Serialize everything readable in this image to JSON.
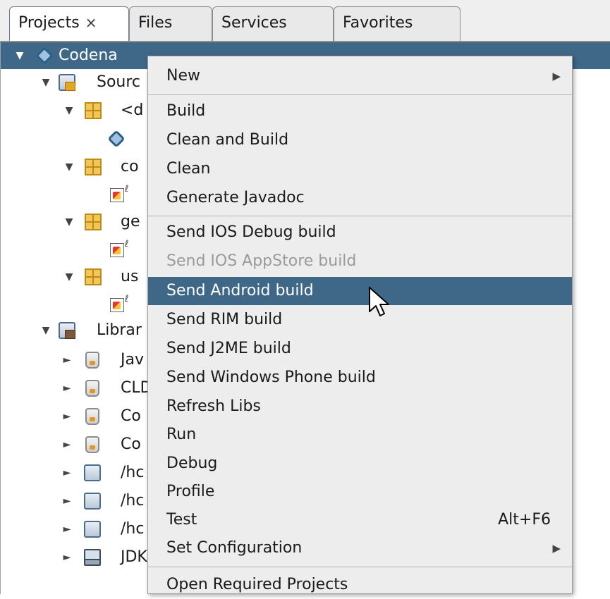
{
  "tabs": [
    {
      "label": "Projects",
      "close": "×"
    },
    {
      "label": "Files"
    },
    {
      "label": "Services"
    },
    {
      "label": "Favorites"
    }
  ],
  "tree": {
    "project": "Codena",
    "source_packages": "Sourc",
    "pkg_default": "<d",
    "pkg_2": "co",
    "pkg_3": "ge",
    "pkg_4": "us",
    "libraries": "Librar",
    "lib_1": "Jav",
    "lib_2": "CLD",
    "lib_3": "Co",
    "lib_4": "Co",
    "lib_5": "/hc",
    "lib_6": "/hc",
    "lib_7": "/hc",
    "lib_8": "JDK",
    "expanded_glyph": "▼",
    "collapsed_glyph": "►"
  },
  "menu": {
    "items": [
      {
        "label": "New",
        "submenu": "▶"
      },
      {
        "label": "Build"
      },
      {
        "label": "Clean and Build"
      },
      {
        "label": "Clean"
      },
      {
        "label": "Generate Javadoc"
      },
      {
        "label": "Send IOS Debug build"
      },
      {
        "label": "Send IOS AppStore build",
        "disabled": true
      },
      {
        "label": "Send Android build",
        "highlighted": true
      },
      {
        "label": "Send RIM build"
      },
      {
        "label": "Send J2ME build"
      },
      {
        "label": "Send Windows Phone build"
      },
      {
        "label": "Refresh Libs"
      },
      {
        "label": "Run"
      },
      {
        "label": "Debug"
      },
      {
        "label": "Profile"
      },
      {
        "label": "Test",
        "shortcut": "Alt+F6"
      },
      {
        "label": "Set Configuration",
        "submenu": "▶"
      },
      {
        "label": "Open Required Projects"
      }
    ]
  },
  "colors": {
    "selection": "#3f6787",
    "menu_bg": "#ededed"
  }
}
